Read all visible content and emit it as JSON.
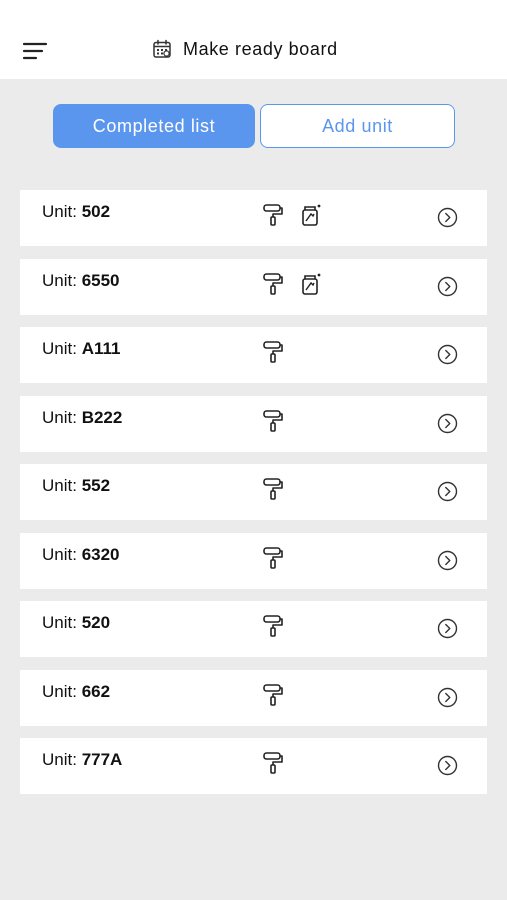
{
  "header": {
    "title": "Make ready board",
    "menu_icon": "hamburger-menu-icon",
    "title_icon": "calendar-icon"
  },
  "tabs": {
    "completed_label": "Completed list",
    "add_label": "Add unit",
    "accent_color": "#5b96ee"
  },
  "units": [
    {
      "prefix": "Unit: ",
      "number": "502",
      "icons": [
        "paint-roller-icon",
        "paint-bucket-icon"
      ]
    },
    {
      "prefix": "Unit: ",
      "number": "6550",
      "icons": [
        "paint-roller-icon",
        "paint-bucket-icon"
      ]
    },
    {
      "prefix": "Unit: ",
      "number": "A111",
      "icons": [
        "paint-roller-icon"
      ]
    },
    {
      "prefix": "Unit: ",
      "number": "B222",
      "icons": [
        "paint-roller-icon"
      ]
    },
    {
      "prefix": "Unit: ",
      "number": "552",
      "icons": [
        "paint-roller-icon"
      ]
    },
    {
      "prefix": "Unit: ",
      "number": "6320",
      "icons": [
        "paint-roller-icon"
      ]
    },
    {
      "prefix": "Unit: ",
      "number": "520",
      "icons": [
        "paint-roller-icon"
      ]
    },
    {
      "prefix": "Unit: ",
      "number": "662",
      "icons": [
        "paint-roller-icon"
      ]
    },
    {
      "prefix": "Unit: ",
      "number": "777A",
      "icons": [
        "paint-roller-icon"
      ]
    }
  ]
}
